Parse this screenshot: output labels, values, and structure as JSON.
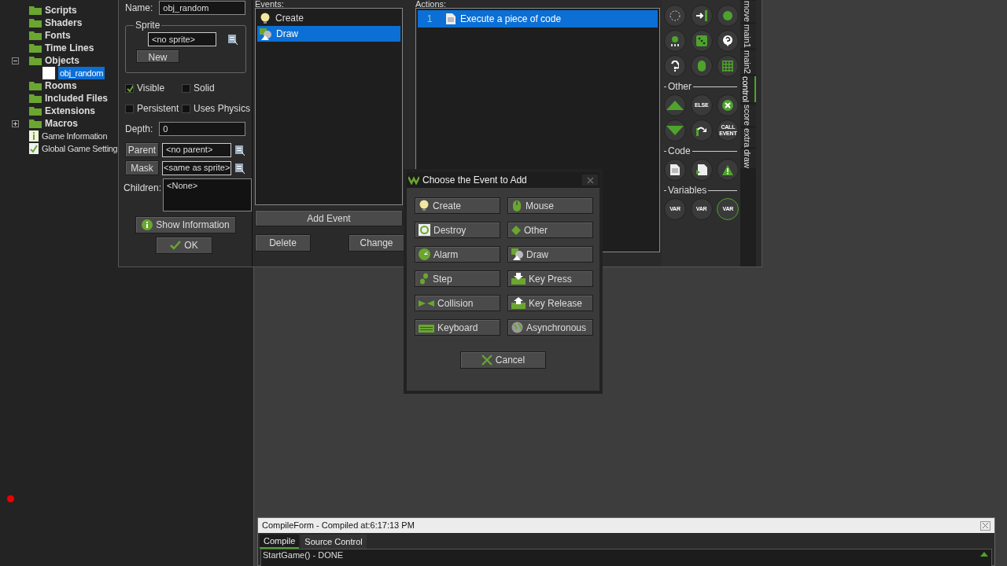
{
  "tree": [
    {
      "label": "Scripts",
      "kind": "folder",
      "bold": true,
      "selected": false
    },
    {
      "label": "Shaders",
      "kind": "folder",
      "bold": true,
      "selected": false
    },
    {
      "label": "Fonts",
      "kind": "folder",
      "bold": true,
      "selected": false
    },
    {
      "label": "Time Lines",
      "kind": "folder",
      "bold": true,
      "selected": false
    },
    {
      "label": "Objects",
      "kind": "folder",
      "bold": true,
      "selected": false,
      "expanded": true,
      "children": [
        {
          "label": "obj_random",
          "kind": "object",
          "bold": false,
          "selected": true
        }
      ]
    },
    {
      "label": "Rooms",
      "kind": "folder",
      "bold": true,
      "selected": false
    },
    {
      "label": "Included Files",
      "kind": "folder",
      "bold": true,
      "selected": false
    },
    {
      "label": "Extensions",
      "kind": "folder",
      "bold": true,
      "selected": false
    },
    {
      "label": "Macros",
      "kind": "folder",
      "bold": true,
      "selected": false,
      "expanded": false
    },
    {
      "label": "Game Information",
      "kind": "info",
      "bold": false,
      "selected": false
    },
    {
      "label": "Global Game Setting",
      "kind": "settings",
      "bold": false,
      "selected": false
    }
  ],
  "object_editor": {
    "name_label": "Name:",
    "name_value": "obj_random",
    "sprite_group": "Sprite",
    "sprite_value": "<no sprite>",
    "new_button": "New",
    "checkboxes": [
      {
        "label": "Visible",
        "checked": true
      },
      {
        "label": "Solid",
        "checked": false
      },
      {
        "label": "Persistent",
        "checked": false
      },
      {
        "label": "Uses Physics",
        "checked": false
      }
    ],
    "depth_label": "Depth:",
    "depth_value": "0",
    "parent_button": "Parent",
    "parent_value": "<no parent>",
    "mask_button": "Mask",
    "mask_value": "<same as sprite>",
    "children_label": "Children:",
    "children_value": "<None>",
    "show_info_button": "Show Information",
    "ok_button": "OK"
  },
  "events": {
    "label": "Events:",
    "items": [
      {
        "label": "Create",
        "kind": "bulb",
        "selected": false
      },
      {
        "label": "Draw",
        "kind": "draw",
        "selected": true
      }
    ],
    "add_button": "Add Event",
    "delete_button": "Delete",
    "change_button": "Change"
  },
  "actions": {
    "label": "Actions:",
    "items": [
      {
        "number": "1",
        "label": "Execute a piece of code",
        "selected": true
      }
    ]
  },
  "palette": {
    "sections": [
      {
        "buttons": [
          {
            "kind": "circle"
          },
          {
            "kind": "arrow-bar"
          },
          {
            "kind": "dot"
          },
          {
            "kind": "counter"
          },
          {
            "kind": "dice"
          },
          {
            "kind": "question-bubble"
          },
          {
            "kind": "question"
          },
          {
            "kind": "mouse"
          },
          {
            "kind": "grid"
          }
        ]
      },
      {
        "title": "Other",
        "buttons": [
          {
            "kind": "up"
          },
          {
            "kind": "text",
            "label": "ELSE"
          },
          {
            "kind": "x"
          },
          {
            "kind": "down"
          },
          {
            "kind": "curve"
          },
          {
            "kind": "text",
            "label": "CALL EVENT"
          }
        ]
      },
      {
        "title": "Code",
        "buttons": [
          {
            "kind": "doc"
          },
          {
            "kind": "doc-arrow"
          },
          {
            "kind": "warning"
          }
        ]
      },
      {
        "title": "Variables",
        "buttons": [
          {
            "kind": "text",
            "label": "VAR"
          },
          {
            "kind": "text",
            "label": "VAR"
          },
          {
            "kind": "text",
            "label": "VAR",
            "selected": true
          }
        ]
      }
    ],
    "tabs": [
      {
        "label": "move",
        "selected": false
      },
      {
        "label": "main1",
        "selected": false
      },
      {
        "label": "main2",
        "selected": false
      },
      {
        "label": "control",
        "selected": true
      },
      {
        "label": "score",
        "selected": false
      },
      {
        "label": "extra",
        "selected": false
      },
      {
        "label": "draw",
        "selected": false
      }
    ]
  },
  "dialog": {
    "title": "Choose the Event to Add",
    "buttons": [
      {
        "label": "Create",
        "kind": "bulb"
      },
      {
        "label": "Mouse",
        "kind": "mouse"
      },
      {
        "label": "Destroy",
        "kind": "recycle"
      },
      {
        "label": "Other",
        "kind": "diamond"
      },
      {
        "label": "Alarm",
        "kind": "clock"
      },
      {
        "label": "Draw",
        "kind": "draw"
      },
      {
        "label": "Step",
        "kind": "steps"
      },
      {
        "label": "Key Press",
        "kind": "key-down"
      },
      {
        "label": "Collision",
        "kind": "collide"
      },
      {
        "label": "Key Release",
        "kind": "key-up"
      },
      {
        "label": "Keyboard",
        "kind": "keyboard"
      },
      {
        "label": "Asynchronous",
        "kind": "globe"
      }
    ],
    "cancel": "Cancel"
  },
  "compile": {
    "title": "CompileForm - Compiled at:6:17:13 PM",
    "tabs": [
      {
        "label": "Compile",
        "selected": true
      },
      {
        "label": "Source Control",
        "selected": false
      }
    ],
    "lines": [
      "StartGame() - DONE"
    ]
  }
}
